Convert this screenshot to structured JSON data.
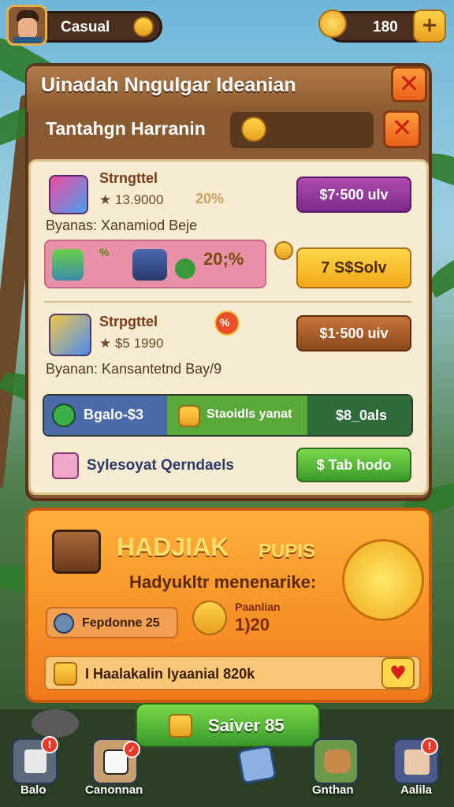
{
  "topbar": {
    "mode_label": "Casual",
    "currency_value": "180",
    "plus_label": "+"
  },
  "dialog": {
    "title": "Uinadah Nngulgar Ideanian",
    "subtitle": "Tantahgn Harranin"
  },
  "offers": [
    {
      "name": "Strngttel",
      "price_line": "★ 13.9000",
      "discount": "20%",
      "desc": "Byanas: Xanamiod Beje",
      "button": "$7·500 ulv"
    },
    {
      "name": "Strpgttel",
      "price_line": "★ $5 1990",
      "discount": "%",
      "desc": "Byanan: Kansantetnd Bay/9",
      "button": "$1·500 uiv"
    }
  ],
  "bundle": {
    "tag": "%",
    "discount": "20;%",
    "button": "7 S$Solv"
  },
  "tabs": [
    {
      "label": "Bgalo-$3",
      "color": "#4a6aa8"
    },
    {
      "label": "Staoidls yanat",
      "color": "#5aa83a"
    },
    {
      "label": "$8_0als",
      "color": "#2f6a3a"
    }
  ],
  "footer_row": {
    "label": "Sylesoyat Qerndaels",
    "button": "$ Tab hodo"
  },
  "bonus": {
    "title": "HADJIAK",
    "title_small": "PUPIS",
    "subtitle": "Hadyukltr menenarike:",
    "timer_label": "Fepdonne 25",
    "countdown_caption": "Paanlian",
    "countdown_value": "1)20",
    "reward_text": "I Haalakalin lyaanial 820k"
  },
  "main_button": "Saiver 85",
  "nav": [
    {
      "label": "Balo",
      "icon": "shirt-icon"
    },
    {
      "label": "Canonnan",
      "icon": "dice-icon"
    },
    {
      "label": "",
      "icon": "cube-icon"
    },
    {
      "label": "Gnthan",
      "icon": "bread-icon"
    },
    {
      "label": "Aalila",
      "icon": "box-icon"
    }
  ],
  "colors": {
    "purple": "#8a2a9a",
    "yellow": "#f0b020",
    "brown": "#a85a2a",
    "green": "#4ab02a",
    "orange": "#f08a20"
  }
}
